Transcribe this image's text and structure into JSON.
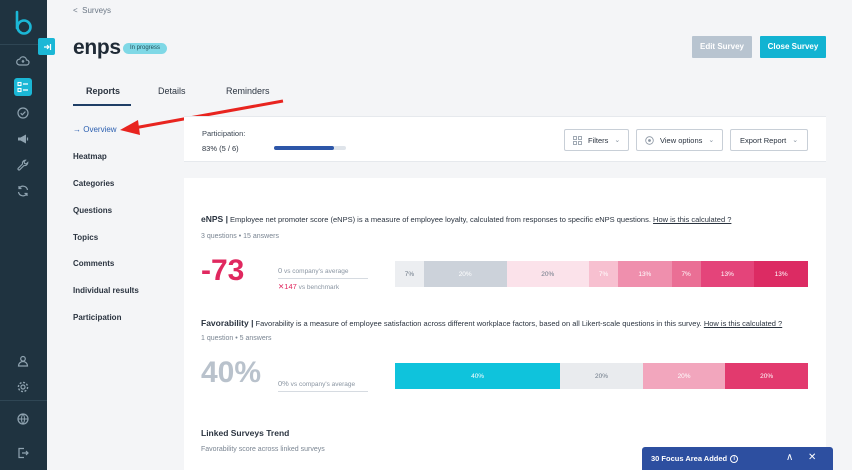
{
  "rail": {
    "icons": [
      "logo-icon",
      "cloud-upload-icon",
      "survey-list-icon",
      "check-circle-icon",
      "megaphone-icon",
      "wrench-icon",
      "sync-icon",
      "user-icon",
      "settings-icon",
      "globe-icon",
      "logout-icon"
    ],
    "active": "survey-list-icon"
  },
  "breadcrumb": {
    "arrow": "<",
    "label": "Surveys"
  },
  "page": {
    "title": "enps",
    "status": "In progress"
  },
  "actions": {
    "edit": "Edit Survey",
    "close": "Close Survey"
  },
  "tabs": [
    {
      "label": "Reports",
      "active": true
    },
    {
      "label": "Details",
      "active": false
    },
    {
      "label": "Reminders",
      "active": false
    }
  ],
  "sidenav": [
    {
      "label": "Overview",
      "active": true
    },
    {
      "label": "Heatmap"
    },
    {
      "label": "Categories"
    },
    {
      "label": "Questions"
    },
    {
      "label": "Topics"
    },
    {
      "label": "Comments"
    },
    {
      "label": "Individual results"
    },
    {
      "label": "Participation"
    }
  ],
  "participation": {
    "label": "Participation:",
    "value": "83% (5 / 6)",
    "progress": 0.83
  },
  "toolbar": {
    "filters": "Filters",
    "view_options": "View options",
    "export": "Export Report"
  },
  "enps": {
    "title": "eNPS |",
    "description": "Employee net promoter score (eNPS) is a measure of employee loyalty, calculated from responses to specific eNPS questions.",
    "link": "How is this calculated ?",
    "meta": "3 questions • 15 answers",
    "score": "-73",
    "vs_company_value": "0",
    "vs_company_label": "vs company's average",
    "vs_benchmark_value": "✕147",
    "vs_benchmark_label": "vs benchmark",
    "segments": [
      {
        "label": "7%",
        "value": 7,
        "color": "#eceef1",
        "text": "#6b7785"
      },
      {
        "label": "20%",
        "value": 20,
        "color": "#ccd2da",
        "text": "#ffffff"
      },
      {
        "label": "20%",
        "value": 20,
        "color": "#fbe2ea",
        "text": "#6b7785"
      },
      {
        "label": "7%",
        "value": 7,
        "color": "#f7c0d0",
        "text": "#ffffff"
      },
      {
        "label": "13%",
        "value": 13,
        "color": "#ef8fad",
        "text": "#ffffff"
      },
      {
        "label": "7%",
        "value": 7,
        "color": "#ea6f95",
        "text": "#ffffff"
      },
      {
        "label": "13%",
        "value": 13,
        "color": "#e4447a",
        "text": "#ffffff"
      },
      {
        "label": "13%",
        "value": 13,
        "color": "#dc2b63",
        "text": "#ffffff"
      }
    ]
  },
  "favorability": {
    "title": "Favorability |",
    "description": "Favorability is a measure of employee satisfaction across different workplace factors, based on all Likert-scale questions in this survey.",
    "link": "How is this calculated ?",
    "meta": "1 question • 5 answers",
    "score": "40%",
    "vs_company_value": "0%",
    "vs_company_label": "vs company's average",
    "segments": [
      {
        "label": "40%",
        "value": 40,
        "color": "#0fc3dc",
        "text": "#ffffff"
      },
      {
        "label": "20%",
        "value": 20,
        "color": "#e9ebee",
        "text": "#6b7785"
      },
      {
        "label": "20%",
        "value": 20,
        "color": "#f2a6bd",
        "text": "#ffffff"
      },
      {
        "label": "20%",
        "value": 20,
        "color": "#e23a6e",
        "text": "#ffffff"
      }
    ]
  },
  "trend": {
    "title": "Linked Surveys Trend",
    "subtitle": "Favorability score across linked surveys"
  },
  "focus_banner": {
    "label": "30 Focus Area Added",
    "info": "i",
    "collapse": "∧",
    "close": "✕"
  },
  "colors": {
    "accent": "#12b3d2",
    "negative": "#e0285f",
    "muted_score": "#b9c2cc",
    "rail": "#1f3340"
  }
}
